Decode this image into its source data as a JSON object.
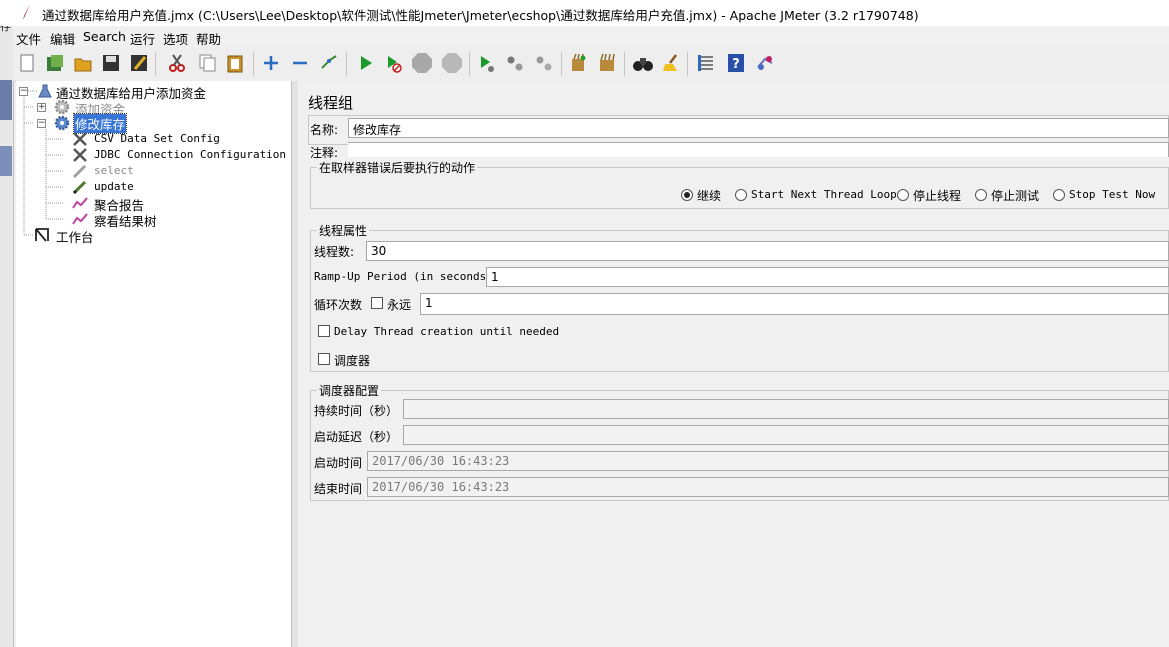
{
  "window": {
    "title": "通过数据库给用户充值.jmx (C:\\Users\\Lee\\Desktop\\软件测试\\性能Jmeter\\Jmeter\\ecshop\\通过数据库给用户充值.jmx) - Apache JMeter (3.2 r1790748)"
  },
  "menu": [
    "文件",
    "编辑",
    "Search",
    "运行",
    "选项",
    "帮助"
  ],
  "tree": {
    "root": "通过数据库给用户添加资金",
    "group1": "添加资金",
    "group2": "修改库存",
    "children": [
      "CSV Data Set Config",
      "JDBC Connection Configuration",
      "select",
      "update",
      "聚合报告",
      "察看结果树"
    ],
    "workbench": "工作台"
  },
  "panel": {
    "heading": "线程组",
    "name_label": "名称:",
    "name_value": "修改库存",
    "comment_label": "注释:",
    "comment_value": "",
    "error_action": {
      "title": "在取样器错误后要执行的动作",
      "options": [
        "继续",
        "Start Next Thread Loop",
        "停止线程",
        "停止测试",
        "Stop Test Now"
      ],
      "selected": "继续"
    },
    "thread_props": {
      "title": "线程属性",
      "threads_label": "线程数:",
      "threads_value": "30",
      "rampup_label": "Ramp-Up Period (in seconds):",
      "rampup_value": "1",
      "loop_label": "循环次数",
      "forever_label": "永远",
      "loop_value": "1",
      "delay_label": "Delay Thread creation until needed",
      "scheduler_label": "调度器"
    },
    "scheduler": {
      "title": "调度器配置",
      "duration_label": "持续时间（秒）",
      "duration_value": "",
      "delay_label": "启动延迟（秒）",
      "delay_value": "",
      "start_label": "启动时间",
      "start_value": "2017/06/30 16:43:23",
      "end_label": "结束时间",
      "end_value": "2017/06/30 16:43:23"
    }
  },
  "colors": {
    "selection": "#3875d7",
    "group_disabled_text": "#8a8a8a"
  }
}
